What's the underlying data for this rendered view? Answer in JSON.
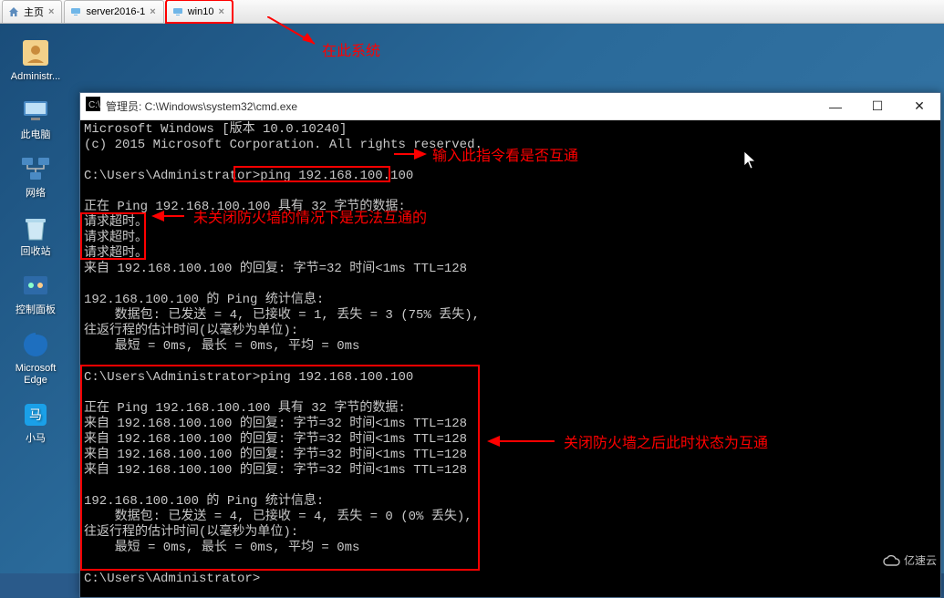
{
  "tabs": {
    "main": {
      "label": "主页"
    },
    "server": {
      "label": "server2016-1"
    },
    "win10": {
      "label": "win10"
    }
  },
  "desktop_icons": {
    "admin": "Administr...",
    "thispc": "此电脑",
    "network": "网络",
    "recycle": "回收站",
    "ctrlpanel": "控制面板",
    "edge": "Microsoft Edge",
    "xiaoma": "小马"
  },
  "cmd": {
    "title": "管理员: C:\\Windows\\system32\\cmd.exe",
    "lines": {
      "l1": "Microsoft Windows [版本 10.0.10240]",
      "l2": "(c) 2015 Microsoft Corporation. All rights reserved.",
      "l3": "",
      "l4": "C:\\Users\\Administrator>ping 192.168.100.100",
      "l5": "",
      "l6": "正在 Ping 192.168.100.100 具有 32 字节的数据:",
      "l7": "请求超时。",
      "l8": "请求超时。",
      "l9": "请求超时。",
      "l10": "来自 192.168.100.100 的回复: 字节=32 时间<1ms TTL=128",
      "l11": "",
      "l12": "192.168.100.100 的 Ping 统计信息:",
      "l13": "    数据包: 已发送 = 4, 已接收 = 1, 丢失 = 3 (75% 丢失),",
      "l14": "往返行程的估计时间(以毫秒为单位):",
      "l15": "    最短 = 0ms, 最长 = 0ms, 平均 = 0ms",
      "l16": "",
      "lA": "C:\\Users\\Administrator>ping 192.168.100.100",
      "lB": "",
      "lC": "正在 Ping 192.168.100.100 具有 32 字节的数据:",
      "lD": "来自 192.168.100.100 的回复: 字节=32 时间<1ms TTL=128",
      "lE": "来自 192.168.100.100 的回复: 字节=32 时间<1ms TTL=128",
      "lF": "来自 192.168.100.100 的回复: 字节=32 时间<1ms TTL=128",
      "lG": "来自 192.168.100.100 的回复: 字节=32 时间<1ms TTL=128",
      "lH": "",
      "lI": "192.168.100.100 的 Ping 统计信息:",
      "lJ": "    数据包: 已发送 = 4, 已接收 = 4, 丢失 = 0 (0% 丢失),",
      "lK": "往返行程的估计时间(以毫秒为单位):",
      "lL": "    最短 = 0ms, 最长 = 0ms, 平均 = 0ms",
      "lM": "",
      "lN": "C:\\Users\\Administrator>"
    }
  },
  "annotations": {
    "tab": "在此系统",
    "ping": "输入此指令看是否互通",
    "firewall_closed": "未关闭防火墙的情况下是无法互通的",
    "firewall_off": "关闭防火墙之后此时状态为互通"
  },
  "watermark": "亿速云"
}
